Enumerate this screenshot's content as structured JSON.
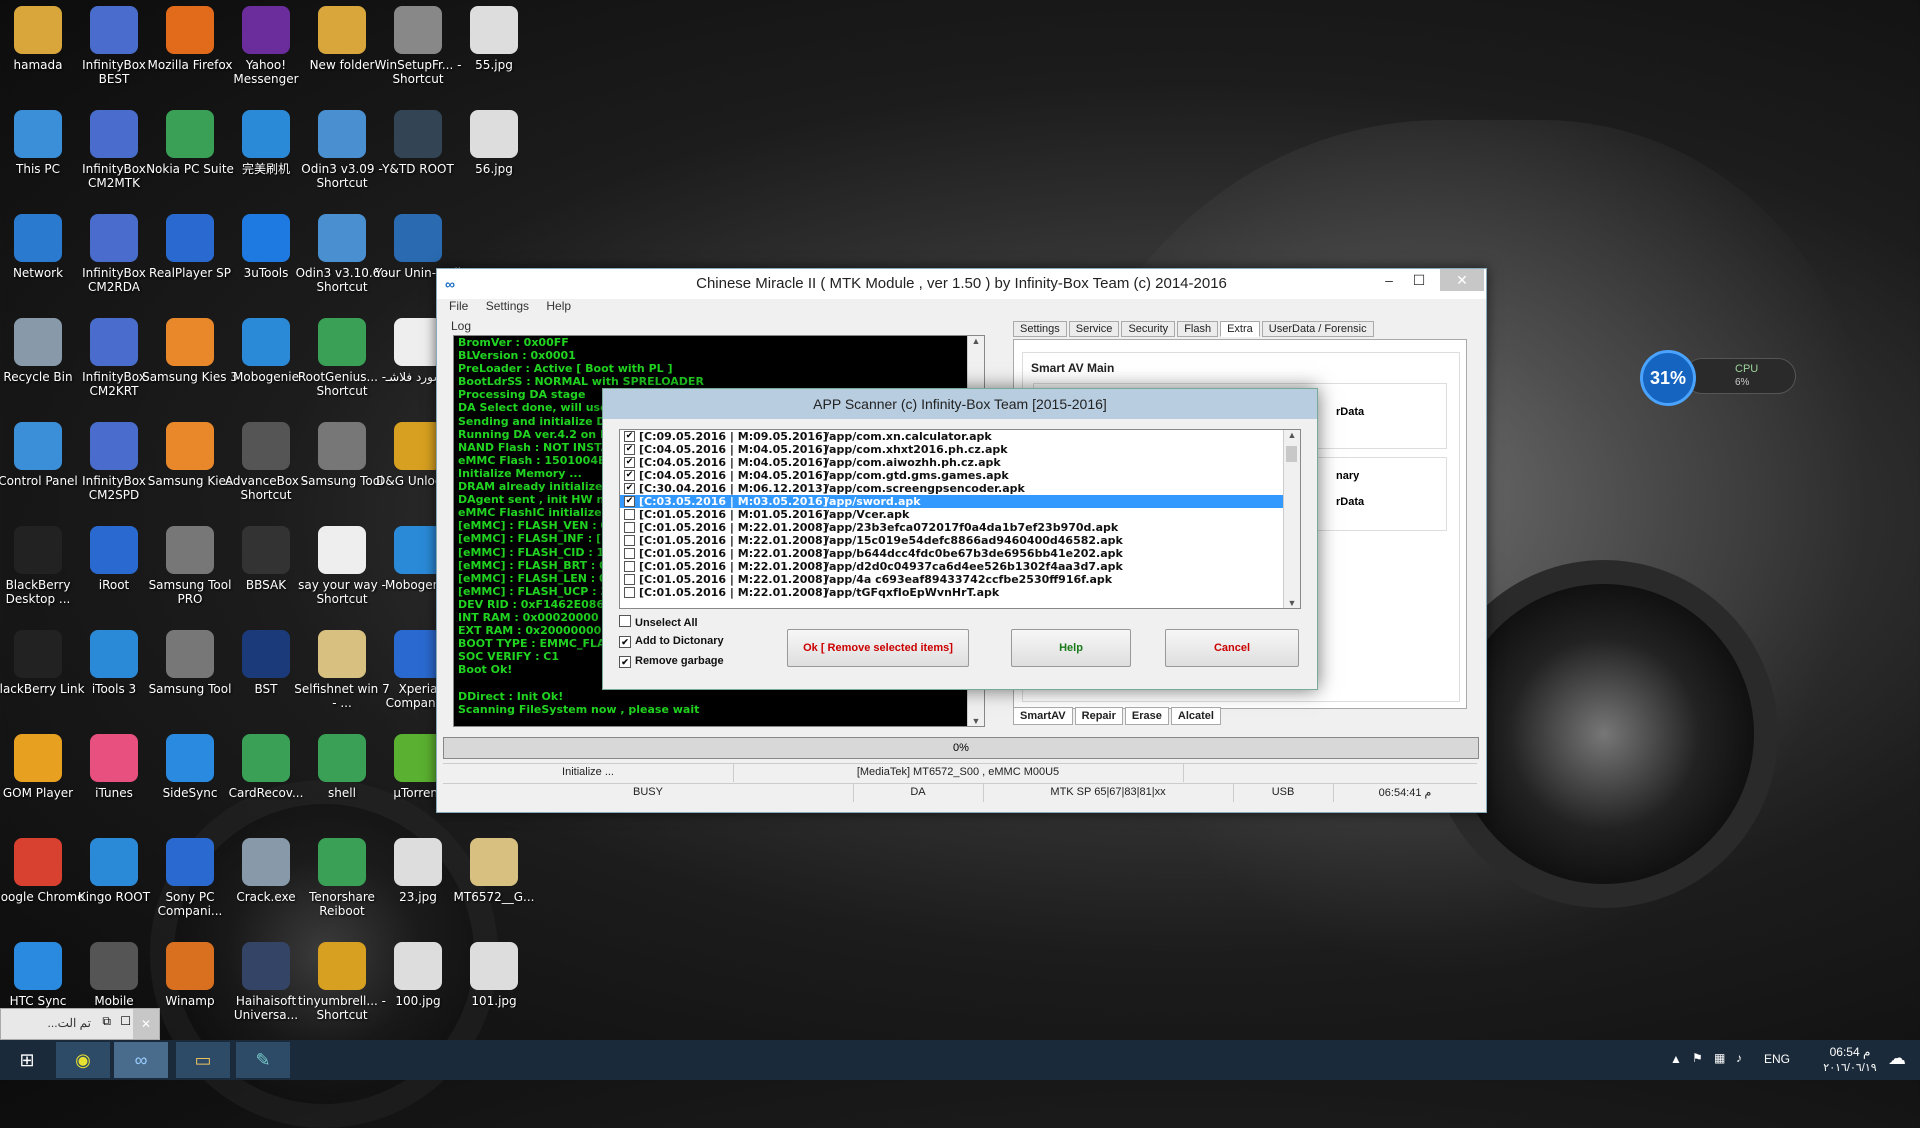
{
  "desktop_icons": [
    {
      "label": "hamada",
      "icon": "folder-icon",
      "color": "#d8a63a",
      "col": 0,
      "row": 0
    },
    {
      "label": "InfinityBox BEST",
      "icon": "infinitybox-icon",
      "color": "#4a6ccc",
      "col": 1,
      "row": 0
    },
    {
      "label": "Mozilla Firefox",
      "icon": "firefox-icon",
      "color": "#e26a1b",
      "col": 2,
      "row": 0
    },
    {
      "label": "Yahoo! Messenger",
      "icon": "yahoo-messenger-icon",
      "color": "#6b2c9c",
      "col": 3,
      "row": 0
    },
    {
      "label": "New folder",
      "icon": "folder-icon",
      "color": "#d8a63a",
      "col": 4,
      "row": 0
    },
    {
      "label": "WinSetupFr... - Shortcut",
      "icon": "usb-icon",
      "color": "#888888",
      "col": 5,
      "row": 0
    },
    {
      "label": "55.jpg",
      "icon": "image-file-icon",
      "color": "#dddddd",
      "col": 6,
      "row": 0
    },
    {
      "label": "This PC",
      "icon": "computer-icon",
      "color": "#3a8fd8",
      "col": 0,
      "row": 1
    },
    {
      "label": "InfinityBox CM2MTK",
      "icon": "infinitybox-icon",
      "color": "#4a6ccc",
      "col": 1,
      "row": 1
    },
    {
      "label": "Nokia PC Suite",
      "icon": "nokia-suite-icon",
      "color": "#3aa055",
      "col": 2,
      "row": 1
    },
    {
      "label": "完美刷机",
      "icon": "flash-tool-icon",
      "color": "#2a8ad8",
      "col": 3,
      "row": 1
    },
    {
      "label": "Odin3 v3.09 - Shortcut",
      "icon": "odin-icon",
      "color": "#4a90d0",
      "col": 4,
      "row": 1
    },
    {
      "label": "Y&TD ROOT",
      "icon": "root-icon",
      "color": "#334455",
      "col": 5,
      "row": 1
    },
    {
      "label": "56.jpg",
      "icon": "image-file-icon",
      "color": "#dddddd",
      "col": 6,
      "row": 1
    },
    {
      "label": "Network",
      "icon": "network-icon",
      "color": "#2a7ad0",
      "col": 0,
      "row": 2
    },
    {
      "label": "InfinityBox CM2RDA",
      "icon": "infinitybox-icon",
      "color": "#4a6ccc",
      "col": 1,
      "row": 2
    },
    {
      "label": "RealPlayer SP",
      "icon": "realplayer-icon",
      "color": "#2a6ad0",
      "col": 2,
      "row": 2
    },
    {
      "label": "3uTools",
      "icon": "3utools-icon",
      "color": "#1e7ae0",
      "col": 3,
      "row": 2
    },
    {
      "label": "Odin3 v3.10.6 - Shortcut",
      "icon": "odin-icon",
      "color": "#4a90d0",
      "col": 4,
      "row": 2
    },
    {
      "label": "Your Unin-stall",
      "icon": "uninstall-icon",
      "color": "#2a6ab0",
      "col": 5,
      "row": 2
    },
    {
      "label": "Recycle Bin",
      "icon": "recycle-bin-icon",
      "color": "#8899aa",
      "col": 0,
      "row": 3
    },
    {
      "label": "InfinityBox CM2KRT",
      "icon": "infinitybox-icon",
      "color": "#4a6ccc",
      "col": 1,
      "row": 3
    },
    {
      "label": "Samsung Kies 3",
      "icon": "kies-icon",
      "color": "#e8882a",
      "col": 2,
      "row": 3
    },
    {
      "label": "Mobogenie",
      "icon": "mobogenie-icon",
      "color": "#2a8ad8",
      "col": 3,
      "row": 3
    },
    {
      "label": "RootGenius... - Shortcut",
      "icon": "rootgenius-icon",
      "color": "#3aa055",
      "col": 4,
      "row": 3
    },
    {
      "label": "پاسورد فلاشـ",
      "icon": "text-file-icon",
      "color": "#eeeeee",
      "col": 5,
      "row": 3
    },
    {
      "label": "Control Panel",
      "icon": "control-panel-icon",
      "color": "#3a8fd8",
      "col": 0,
      "row": 4
    },
    {
      "label": "InfinityBox CM2SPD",
      "icon": "infinitybox-icon",
      "color": "#4a6ccc",
      "col": 1,
      "row": 4
    },
    {
      "label": "Samsung Kies",
      "icon": "kies-icon",
      "color": "#e8882a",
      "col": 2,
      "row": 4
    },
    {
      "label": "AdvanceBox - Shortcut",
      "icon": "advancebox-icon",
      "color": "#555555",
      "col": 3,
      "row": 4
    },
    {
      "label": "Samsung Tool",
      "icon": "gear-icon",
      "color": "#777777",
      "col": 4,
      "row": 4
    },
    {
      "label": "D&G Unlock...",
      "icon": "dg-unlock-icon",
      "color": "#d8a020",
      "col": 5,
      "row": 4
    },
    {
      "label": "BlackBerry Desktop ...",
      "icon": "blackberry-icon",
      "color": "#222222",
      "col": 0,
      "row": 5
    },
    {
      "label": "iRoot",
      "icon": "anchor-icon",
      "color": "#2a6ad0",
      "col": 1,
      "row": 5
    },
    {
      "label": "Samsung Tool PRO",
      "icon": "gear-icon",
      "color": "#777777",
      "col": 2,
      "row": 5
    },
    {
      "label": "BBSAK",
      "icon": "bbsak-icon",
      "color": "#333333",
      "col": 3,
      "row": 5
    },
    {
      "label": "say your way - Shortcut",
      "icon": "text-file-icon",
      "color": "#eeeeee",
      "col": 4,
      "row": 5
    },
    {
      "label": "Mobogenie",
      "icon": "mobogenie-icon",
      "color": "#2a8ad8",
      "col": 5,
      "row": 5
    },
    {
      "label": "BlackBerry Link",
      "icon": "blackberry-icon",
      "color": "#222222",
      "col": 0,
      "row": 6
    },
    {
      "label": "iTools 3",
      "icon": "itools-icon",
      "color": "#2a8ad8",
      "col": 1,
      "row": 6
    },
    {
      "label": "Samsung Tool",
      "icon": "gear-icon",
      "color": "#777777",
      "col": 2,
      "row": 6
    },
    {
      "label": "BST",
      "icon": "bst-icon",
      "color": "#1a3a7a",
      "col": 3,
      "row": 6
    },
    {
      "label": "Selfishnet win 7 - ...",
      "icon": "folder-icon",
      "color": "#d8c080",
      "col": 4,
      "row": 6
    },
    {
      "label": "Xperia Compani...",
      "icon": "xperia-icon",
      "color": "#2a6ad0",
      "col": 5,
      "row": 6
    },
    {
      "label": "GOM Player",
      "icon": "gom-player-icon",
      "color": "#e8a020",
      "col": 0,
      "row": 7
    },
    {
      "label": "iTunes",
      "icon": "itunes-icon",
      "color": "#e85080",
      "col": 1,
      "row": 7
    },
    {
      "label": "SideSync",
      "icon": "sidesync-icon",
      "color": "#2a8ae0",
      "col": 2,
      "row": 7
    },
    {
      "label": "CardRecov...",
      "icon": "card-recovery-icon",
      "color": "#3aa055",
      "col": 3,
      "row": 7
    },
    {
      "label": "shell",
      "icon": "shell-icon",
      "color": "#3aa055",
      "col": 4,
      "row": 7
    },
    {
      "label": "µTorrent",
      "icon": "utorrent-icon",
      "color": "#5ab030",
      "col": 5,
      "row": 7
    },
    {
      "label": "Google Chrome",
      "icon": "chrome-icon",
      "color": "#d84030",
      "col": 0,
      "row": 8
    },
    {
      "label": "Kingo ROOT",
      "icon": "kingo-root-icon",
      "color": "#2a8ad8",
      "col": 1,
      "row": 8
    },
    {
      "label": "Sony PC Compani...",
      "icon": "sony-pc-icon",
      "color": "#2a6ad0",
      "col": 2,
      "row": 8
    },
    {
      "label": "Crack.exe",
      "icon": "cd-icon",
      "color": "#8899aa",
      "col": 3,
      "row": 8
    },
    {
      "label": "Tenorshare Reiboot",
      "icon": "tenorshare-icon",
      "color": "#3aa055",
      "col": 4,
      "row": 8
    },
    {
      "label": "23.jpg",
      "icon": "image-file-icon",
      "color": "#dddddd",
      "col": 5,
      "row": 8
    },
    {
      "label": "MT6572__G...",
      "icon": "folder-icon",
      "color": "#d8c080",
      "col": 6,
      "row": 8
    },
    {
      "label": "HTC Sync",
      "icon": "htc-sync-icon",
      "color": "#2a8ae0",
      "col": 0,
      "row": 9
    },
    {
      "label": "Mobile",
      "icon": "gear-icon",
      "color": "#555555",
      "col": 1,
      "row": 9
    },
    {
      "label": "Winamp",
      "icon": "winamp-icon",
      "color": "#d87020",
      "col": 2,
      "row": 9
    },
    {
      "label": "Haihaisoft Universa...",
      "icon": "haihaisoft-icon",
      "color": "#334466",
      "col": 3,
      "row": 9
    },
    {
      "label": "tinyumbrell... - Shortcut",
      "icon": "tinyumbrella-icon",
      "color": "#d8a020",
      "col": 4,
      "row": 9
    },
    {
      "label": "100.jpg",
      "icon": "image-file-icon",
      "color": "#dddddd",
      "col": 5,
      "row": 9
    },
    {
      "label": "101.jpg",
      "icon": "image-file-icon",
      "color": "#dddddd",
      "col": 6,
      "row": 9
    }
  ],
  "main_window": {
    "title": "Chinese Miracle II ( MTK Module , ver 1.50 ) by Infinity-Box Team (c) 2014-2016",
    "menu": [
      "File",
      "Settings",
      "Help"
    ],
    "log_label": "Log",
    "log_lines": [
      "BromVer  : 0x00FF",
      "BLVersion : 0x0001",
      "PreLoader : Active [ Boot with PL ]",
      "BootLdrSS : NORMAL with SPRELOADER",
      "Processing DA stage",
      "DA Select done, will use MT",
      "Sending and initialize DA ...",
      "Running DA ver.4.2 on BBID",
      "NAND Flash : NOT INSTALLE",
      "eMMC Flash : 1501004E355",
      "Initialize Memory ...",
      "DRAM already initialized b",
      "DAgent sent , init HW now",
      "eMMC FlashIC initialized",
      "[eMMC] : FLASH_VEN : 0x15",
      "[eMMC] : FLASH_INF : [SAM",
      "[eMMC] : FLASH_CID : 150",
      "[eMMC] : FLASH_BRT : 0x0",
      "[eMMC] : FLASH_LEN : 0x00",
      "[eMMC] : FLASH_UCP : 372",
      "DEV RID   : 0xF1462E0867",
      "INT RAM   : 0x00020000",
      "EXT RAM   : 0x20000000 [",
      "BOOT TYPE : EMMC_FLASH",
      "SOC VERIFY : C1",
      "Boot Ok!",
      "",
      "DDirect : Init Ok!",
      "Scanning FileSystem now , please wait"
    ],
    "tabs": [
      "Settings",
      "Service",
      "Security",
      "Flash",
      "Extra",
      "UserData / Forensic"
    ],
    "active_tab": "Extra",
    "group_title": "Smart AV Main",
    "partial_labels": [
      "rData",
      "nary",
      "rData"
    ],
    "bottom_tabs": [
      "SmartAV",
      "Repair",
      "Erase",
      "Alcatel"
    ],
    "progress_text": "0%",
    "status_row1": [
      "Initialize ...",
      "[MediaTek] MT6572_S00 , eMMC M00U5"
    ],
    "status_row2": [
      "BUSY",
      "DA",
      "MTK SP 65|67|83|81|xx",
      "USB",
      "06:54:41 م"
    ]
  },
  "modal": {
    "title": "APP Scanner (c) Infinity-Box Team [2015-2016]",
    "items": [
      {
        "checked": true,
        "date": "[C:09.05.2016 | M:09.05.2016]",
        "path": "/app/com.xn.calculator.apk",
        "selected": false
      },
      {
        "checked": true,
        "date": "[C:04.05.2016 | M:04.05.2016]",
        "path": "/app/com.xhxt2016.ph.cz.apk",
        "selected": false
      },
      {
        "checked": true,
        "date": "[C:04.05.2016 | M:04.05.2016]",
        "path": "/app/com.aiwozhh.ph.cz.apk",
        "selected": false
      },
      {
        "checked": true,
        "date": "[C:04.05.2016 | M:04.05.2016]",
        "path": "/app/com.gtd.gms.games.apk",
        "selected": false
      },
      {
        "checked": true,
        "date": "[C:30.04.2016 | M:06.12.2013]",
        "path": "/app/com.screengpsencoder.apk",
        "selected": false
      },
      {
        "checked": true,
        "date": "[C:03.05.2016 | M:03.05.2016]",
        "path": "/app/sword.apk",
        "selected": true
      },
      {
        "checked": false,
        "date": "[C:01.05.2016 | M:01.05.2016]",
        "path": "/app/Vcer.apk",
        "selected": false
      },
      {
        "checked": false,
        "date": "[C:01.05.2016 | M:22.01.2008]",
        "path": "/app/23b3efca072017f0a4da1b7ef23b970d.apk",
        "selected": false
      },
      {
        "checked": false,
        "date": "[C:01.05.2016 | M:22.01.2008]",
        "path": "/app/15c019e54defc8866ad9460400d46582.apk",
        "selected": false
      },
      {
        "checked": false,
        "date": "[C:01.05.2016 | M:22.01.2008]",
        "path": "/app/b644dcc4fdc0be67b3de6956bb41e202.apk",
        "selected": false
      },
      {
        "checked": false,
        "date": "[C:01.05.2016 | M:22.01.2008]",
        "path": "/app/d2d0c04937ca6d4ee526b1302f4aa3d7.apk",
        "selected": false
      },
      {
        "checked": false,
        "date": "[C:01.05.2016 | M:22.01.2008]",
        "path": "/app/4a c693eaf89433742ccfbe2530ff916f.apk",
        "selected": false
      },
      {
        "checked": false,
        "date": "[C:01.05.2016 | M:22.01.2008]",
        "path": "/app/tGFqxfIoEpWvnHrT.apk",
        "selected": false
      }
    ],
    "options": [
      {
        "label": "Unselect All",
        "checked": false
      },
      {
        "label": "Add to Dictonary",
        "checked": true
      },
      {
        "label": "Remove garbage",
        "checked": true
      }
    ],
    "buttons": {
      "ok": "Ok [ Remove selected items]",
      "help": "Help",
      "cancel": "Cancel"
    }
  },
  "widget": {
    "percent": "31%",
    "label": "CPU",
    "value": "6%"
  },
  "minimized_window": {
    "title": "...تم الت"
  },
  "taskbar": {
    "tray_lang": "ENG",
    "time": "06:54 م",
    "date": "٢٠١٦/٠٦/١٩"
  },
  "colors": {
    "log_text": "#21d321",
    "ok_button_text": "#cc0000",
    "help_button_text": "#1a7a1a",
    "cancel_button_text": "#cc0000",
    "selection": "#3399ff"
  }
}
